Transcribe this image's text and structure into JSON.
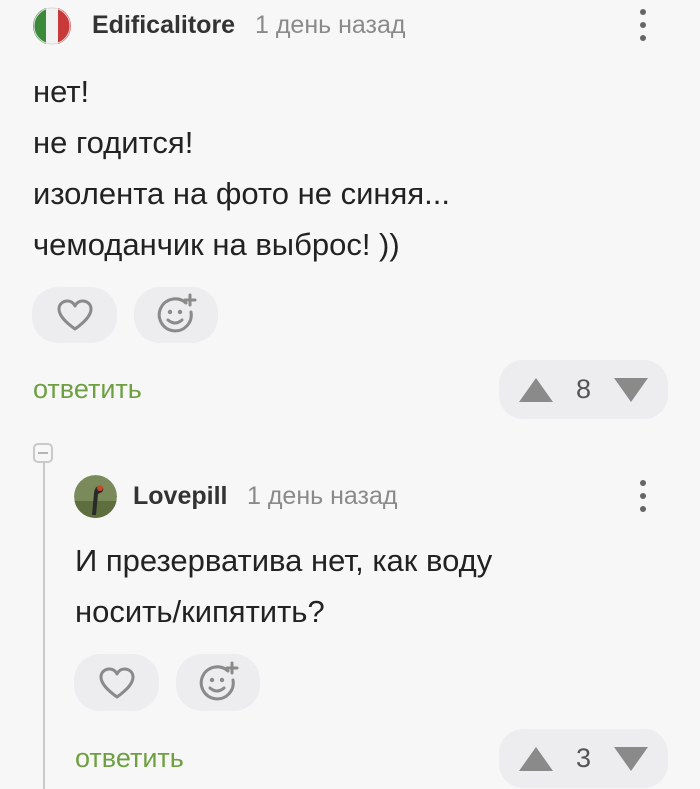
{
  "comments": [
    {
      "username": "Edificalitore",
      "time": "1 день назад",
      "body_lines": [
        "нет!",
        "не годится!",
        "изолента на фото не синяя...",
        "чемоданчик на выброс! ))"
      ],
      "reply_label": "ответить",
      "rating": "8"
    },
    {
      "username": "Lovepill",
      "time": "1 день назад",
      "body_lines": [
        "И презерватива нет, как воду",
        "носить/кипятить?"
      ],
      "reply_label": "ответить",
      "rating": "3"
    }
  ],
  "colors": {
    "reply": "#6ea042",
    "icon": "#8a8a8a",
    "pill": "#ededf0",
    "background": "#f7f7f8"
  },
  "icons": [
    "more-vertical-icon",
    "heart-icon",
    "emoji-add-icon",
    "upvote-arrow-icon",
    "downvote-arrow-icon",
    "collapse-thread-icon"
  ]
}
